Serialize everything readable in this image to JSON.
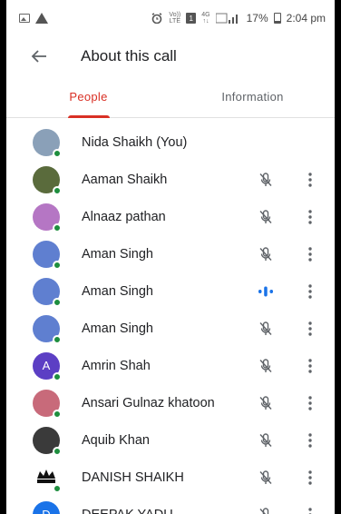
{
  "status_bar": {
    "volte_top": "Vo))",
    "volte_bottom": "LTE",
    "sim": "1",
    "network_top": "4G",
    "network_bottom": "↑↓",
    "battery_percent": "17%",
    "time": "2:04 pm"
  },
  "header": {
    "title": "About this call"
  },
  "tabs": [
    {
      "label": "People",
      "active": true
    },
    {
      "label": "Information",
      "active": false
    }
  ],
  "participants": [
    {
      "name": "Nida Shaikh (You)",
      "avatar_letter": "",
      "avatar_color": "#8aa0b8",
      "mic": "none"
    },
    {
      "name": "Aaman Shaikh",
      "avatar_letter": "",
      "avatar_color": "#5a6b3c",
      "mic": "muted"
    },
    {
      "name": "Alnaaz pathan",
      "avatar_letter": "",
      "avatar_color": "#b576c4",
      "mic": "muted"
    },
    {
      "name": "Aman Singh",
      "avatar_letter": "",
      "avatar_color": "#5f7fd0",
      "mic": "muted"
    },
    {
      "name": "Aman Singh",
      "avatar_letter": "",
      "avatar_color": "#5f7fd0",
      "mic": "speaking"
    },
    {
      "name": "Aman Singh",
      "avatar_letter": "",
      "avatar_color": "#5f7fd0",
      "mic": "muted"
    },
    {
      "name": "Amrin Shah",
      "avatar_letter": "A",
      "avatar_color": "#5c3fc4",
      "mic": "muted"
    },
    {
      "name": "Ansari Gulnaz khatoon",
      "avatar_letter": "",
      "avatar_color": "#c86a7a",
      "mic": "muted"
    },
    {
      "name": "Aquib Khan",
      "avatar_letter": "",
      "avatar_color": "#3a3a3a",
      "mic": "muted"
    },
    {
      "name": "DANISH SHAIKH",
      "avatar_letter": "",
      "avatar_color": "#ffffff",
      "mic": "muted"
    },
    {
      "name": "DEEPAK YADU",
      "avatar_letter": "D",
      "avatar_color": "#1a73e8",
      "mic": "muted"
    }
  ],
  "colors": {
    "accent": "#d93025",
    "online": "#1e8e3e",
    "speaking": "#1a73e8",
    "muted_icon": "#5f6368"
  }
}
